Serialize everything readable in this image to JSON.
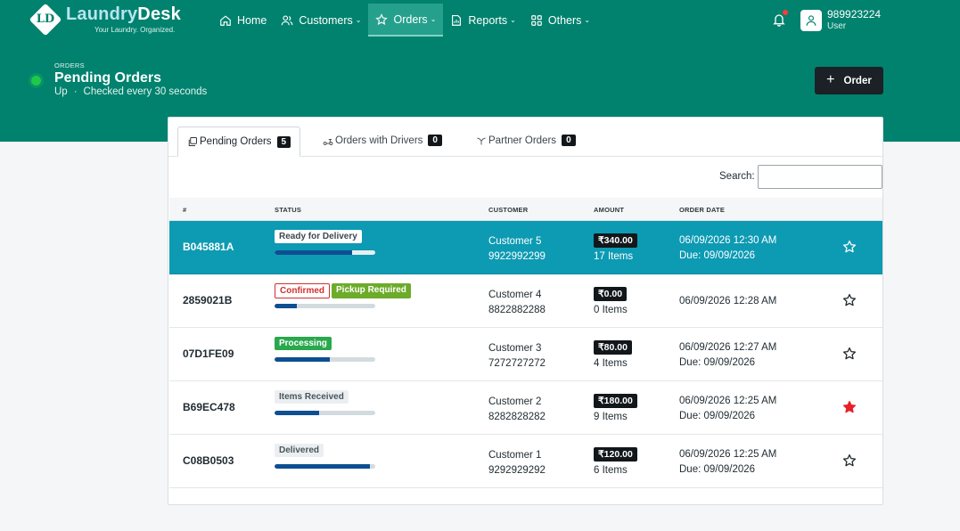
{
  "brand": {
    "name_part1": "Laundry",
    "name_part2": "Desk",
    "tagline": "Your Laundry. Organized.",
    "badge": "LD"
  },
  "nav": [
    {
      "label": "Home",
      "icon": "home-icon",
      "dropdown": false,
      "active": false
    },
    {
      "label": "Customers",
      "icon": "users-icon",
      "dropdown": true,
      "active": false
    },
    {
      "label": "Orders",
      "icon": "star-icon",
      "dropdown": true,
      "active": true
    },
    {
      "label": "Reports",
      "icon": "reports-icon",
      "dropdown": true,
      "active": false
    },
    {
      "label": "Others",
      "icon": "grid-icon",
      "dropdown": true,
      "active": false
    }
  ],
  "user": {
    "phone": "989923224",
    "role": "User"
  },
  "header": {
    "eyebrow": "ORDERS",
    "title": "Pending Orders",
    "status": "Up",
    "separator": "·",
    "check_text": "Checked every 30 seconds",
    "new_order_label": "Order"
  },
  "tabs": [
    {
      "label": "Pending Orders",
      "count": "5",
      "icon": "copy-icon",
      "active": true
    },
    {
      "label": "Orders with Drivers",
      "count": "0",
      "icon": "scooter-icon",
      "active": false
    },
    {
      "label": "Partner Orders",
      "count": "0",
      "icon": "handshake-icon",
      "active": false
    }
  ],
  "search": {
    "label": "Search:",
    "value": ""
  },
  "columns": {
    "id": "#",
    "status": "STATUS",
    "customer": "CUSTOMER",
    "amount": "AMOUNT",
    "date": "ORDER DATE"
  },
  "orders": [
    {
      "id": "B045881A",
      "badges": [
        {
          "text": "Ready for Delivery",
          "style": "white"
        }
      ],
      "progress": 0.77,
      "customer": "Customer 5",
      "phone": "9922992299",
      "amount": "₹340.00",
      "items": "17 Items",
      "date": "06/09/2026 12:30 AM",
      "due": "Due: 09/09/2026",
      "starred": false,
      "selected": true
    },
    {
      "id": "2859021B",
      "badges": [
        {
          "text": "Confirmed",
          "style": "confirmed"
        },
        {
          "text": "Pickup Required",
          "style": "pickup"
        }
      ],
      "progress": 0.22,
      "customer": "Customer 4",
      "phone": "8822882288",
      "amount": "₹0.00",
      "items": "0 Items",
      "date": "06/09/2026 12:28 AM",
      "due": "",
      "starred": false,
      "selected": false
    },
    {
      "id": "07D1FE09",
      "badges": [
        {
          "text": "Processing",
          "style": "green"
        }
      ],
      "progress": 0.55,
      "customer": "Customer 3",
      "phone": "7272727272",
      "amount": "₹80.00",
      "items": "4 Items",
      "date": "06/09/2026 12:27 AM",
      "due": "Due: 09/09/2026",
      "starred": false,
      "selected": false
    },
    {
      "id": "B69EC478",
      "badges": [
        {
          "text": "Items Received",
          "style": "light"
        }
      ],
      "progress": 0.44,
      "customer": "Customer 2",
      "phone": "8282828282",
      "amount": "₹180.00",
      "items": "9 Items",
      "date": "06/09/2026 12:25 AM",
      "due": "Due: 09/09/2026",
      "starred": true,
      "selected": false
    },
    {
      "id": "C08B0503",
      "badges": [
        {
          "text": "Delivered",
          "style": "light"
        }
      ],
      "progress": 0.95,
      "customer": "Customer 1",
      "phone": "9292929292",
      "amount": "₹120.00",
      "items": "6 Items",
      "date": "06/09/2026 12:25 AM",
      "due": "Due: 09/09/2026",
      "starred": false,
      "selected": false
    }
  ],
  "colors": {
    "primary": "#00826e",
    "selected_row": "#0d9ab3",
    "progress": "#0d4f92",
    "star_active": "#e8202a"
  }
}
